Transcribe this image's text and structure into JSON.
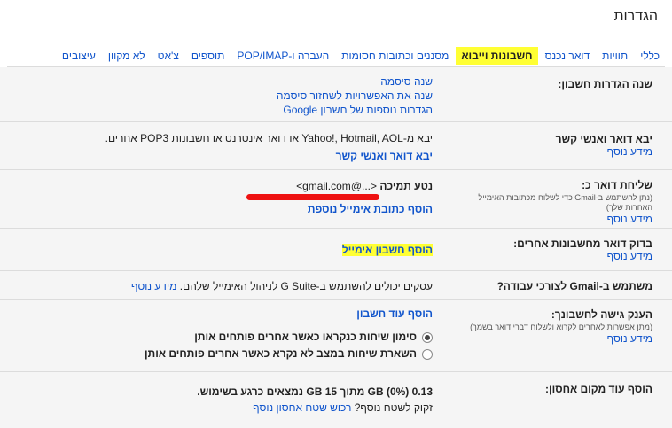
{
  "page_title": "הגדרות",
  "tabs": [
    {
      "label": "כללי"
    },
    {
      "label": "תוויות"
    },
    {
      "label": "דואר נכנס"
    },
    {
      "label": "חשבונות וייבוא",
      "active": true
    },
    {
      "label": "מסננים וכתובות חסומות"
    },
    {
      "label": "העברה ו-POP/IMAP"
    },
    {
      "label": "תוספים"
    },
    {
      "label": "צ'אט"
    },
    {
      "label": "לא מקוון"
    },
    {
      "label": "עיצובים"
    }
  ],
  "change_settings": {
    "label": "שנה הגדרות חשבון:",
    "links": [
      "שנה סיסמה",
      "שנה את האפשרויות לשחזור סיסמה",
      "הגדרות נוספות של חשבון Google"
    ]
  },
  "import": {
    "label": "יבא דואר ואנשי קשר",
    "learn_more": "מידע נוסף",
    "desc": "יבא מ-Yahoo!, Hotmail, AOL או דואר אינטרנט או חשבונות POP3 אחרים.",
    "action": "יבא דואר ואנשי קשר"
  },
  "send_as": {
    "label": "שליחת דואר כ:",
    "sub": "(נתן להשתמש ב-Gmail כדי לשלוח מכתובות האימייל האחרות שלך)",
    "learn_more": "מידע נוסף",
    "entry_name": "נטע תמיכה",
    "entry_email": "<...@gmail.com>",
    "action": "הוסף כתובת אימייל נוספת"
  },
  "check_mail": {
    "label": "בדוק דואר מחשבונות אחרים:",
    "learn_more": "מידע נוסף",
    "action": "הוסף חשבון אימייל"
  },
  "gsuite": {
    "label": "משתמש ב-Gmail לצורכי עבודה?",
    "desc": "עסקים יכולים להשתמש ב-G Suite לניהול האימייל שלהם.",
    "learn_more": "מידע נוסף"
  },
  "grant_access": {
    "label": "הענק גישה לחשבונך:",
    "sub": "(מתן אפשרות לאחרים לקרוא ולשלוח דברי דואר בשמך)",
    "learn_more": "מידע נוסף",
    "action": "הוסף עוד חשבון",
    "options": [
      {
        "label": "סימון שיחות כנקראו כאשר אחרים פותחים אותן",
        "checked": true
      },
      {
        "label": "השארת שיחות במצב לא נקרא כאשר אחרים פותחים אותן",
        "checked": false
      }
    ]
  },
  "storage": {
    "label": "הוסף עוד מקום אחסון:",
    "usage": "0.13 GB (0%) מתוך 15 GB נמצאים כרגע בשימוש.",
    "need_more": "זקוק לשטח נוסף?",
    "purchase": "רכוש שטח אחסון נוסף"
  }
}
